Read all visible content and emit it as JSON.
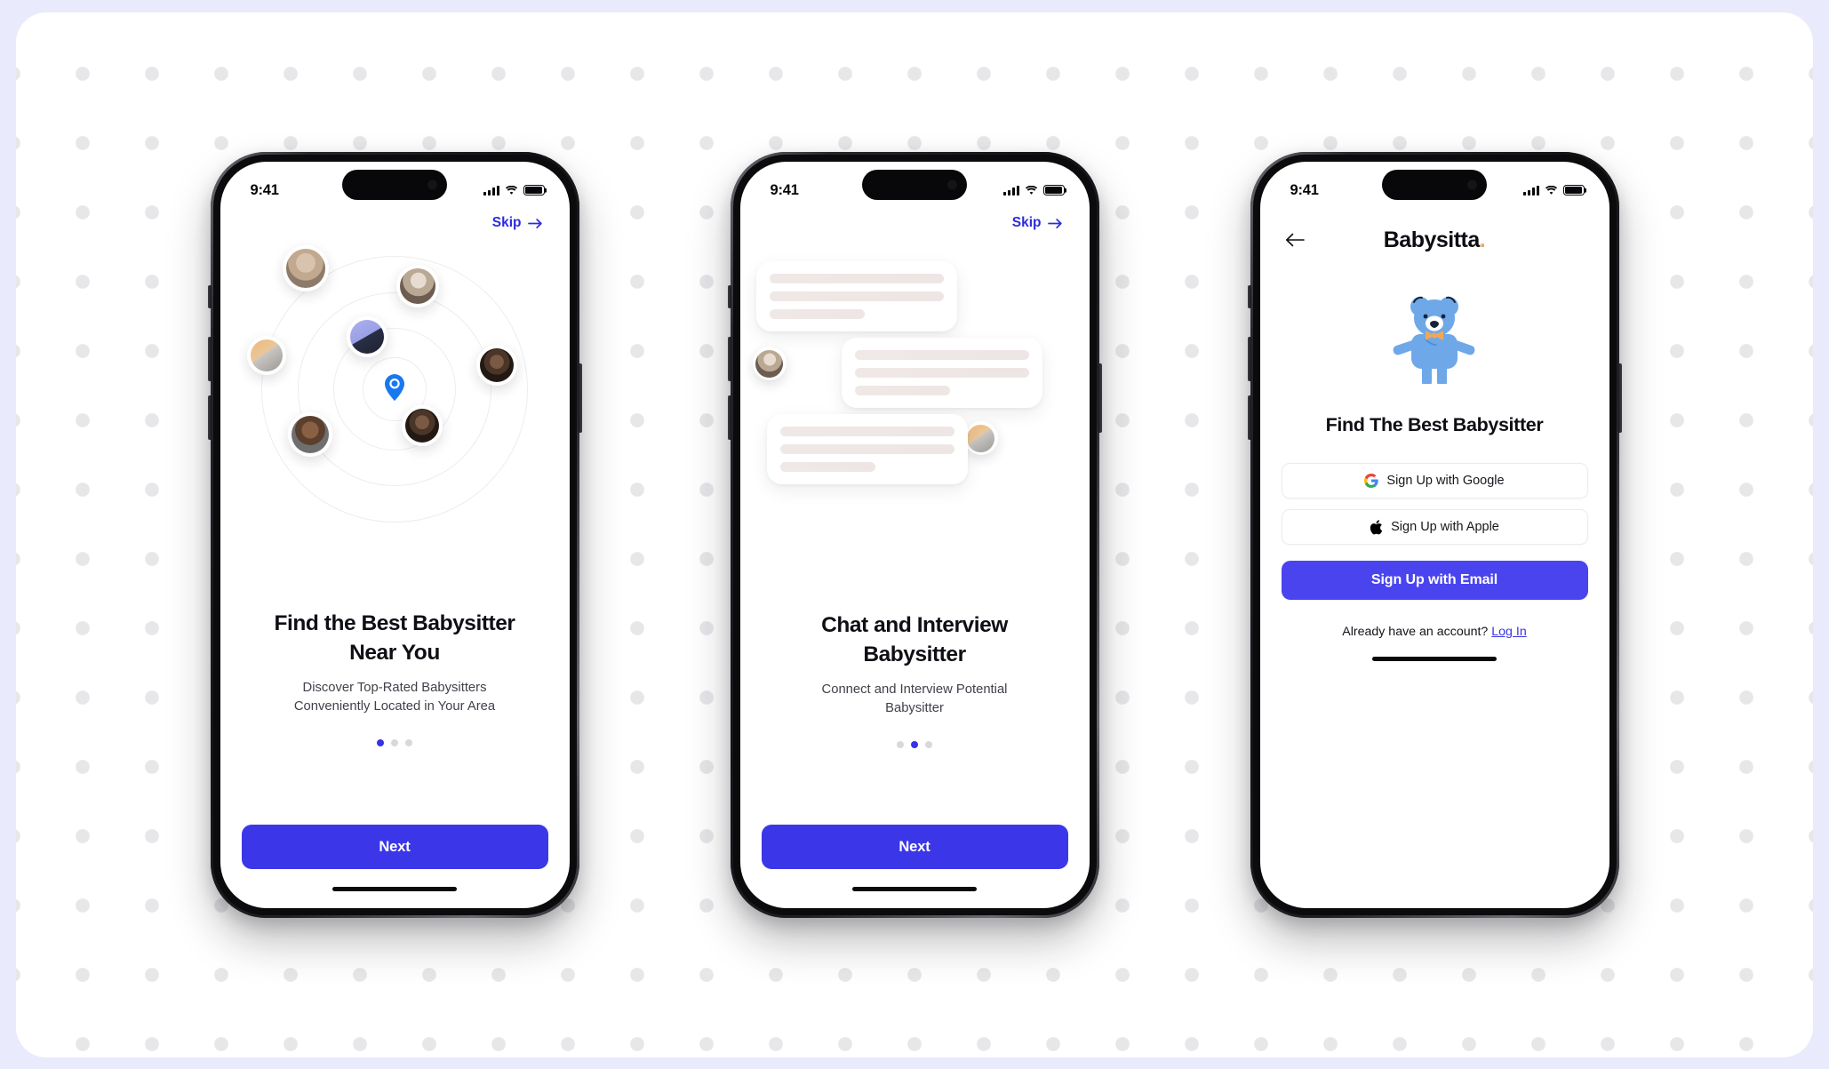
{
  "theme": {
    "page_bg": "#e9eafb",
    "panel_bg": "#ffffff",
    "dot_color": "#e7e7e9",
    "primary_blue": "#3b37e8",
    "link_blue": "#2b2be0",
    "brand_accent": "#eda75c",
    "bear_blue": "#6ea8e8"
  },
  "status_bar": {
    "time": "9:41",
    "signal_icon": "cellular-signal-icon",
    "wifi_icon": "wifi-icon",
    "battery_icon": "battery-full-icon"
  },
  "screens": [
    {
      "id": "onboarding-location",
      "skip_label": "Skip",
      "skip_icon": "arrow-right-icon",
      "illustration": "radar-nearby-babysitters",
      "title": "Find the Best Babysitter Near You",
      "title_line1": "Find the Best Babysitter",
      "title_line2": "Near You",
      "subtitle_line1": "Discover Top-Rated Babysitters",
      "subtitle_line2": "Conveniently Located in Your Area",
      "pagination": {
        "total": 3,
        "active": 1
      },
      "cta_label": "Next"
    },
    {
      "id": "onboarding-chat",
      "skip_label": "Skip",
      "skip_icon": "arrow-right-icon",
      "illustration": "chat-bubbles-placeholder",
      "title": "Chat and Interview Babysitter",
      "title_line1": "Chat and Interview",
      "title_line2": "Babysitter",
      "subtitle_line1": "Connect and Interview Potential",
      "subtitle_line2": "Babysitter",
      "pagination": {
        "total": 3,
        "active": 2
      },
      "cta_label": "Next"
    },
    {
      "id": "signup",
      "back_icon": "arrow-left-icon",
      "brand_name": "Babysitta",
      "brand_dot": ".",
      "illustration": "teddy-bear-icon",
      "title": "Find The Best Babysitter",
      "buttons": [
        {
          "label": "Sign Up with Google",
          "icon": "google-icon",
          "style": "outline"
        },
        {
          "label": "Sign Up with Apple",
          "icon": "apple-icon",
          "style": "outline"
        },
        {
          "label": "Sign Up with Email",
          "icon": "",
          "style": "primary"
        }
      ],
      "footer_text": "Already have an account?",
      "footer_link": "Log In"
    }
  ]
}
